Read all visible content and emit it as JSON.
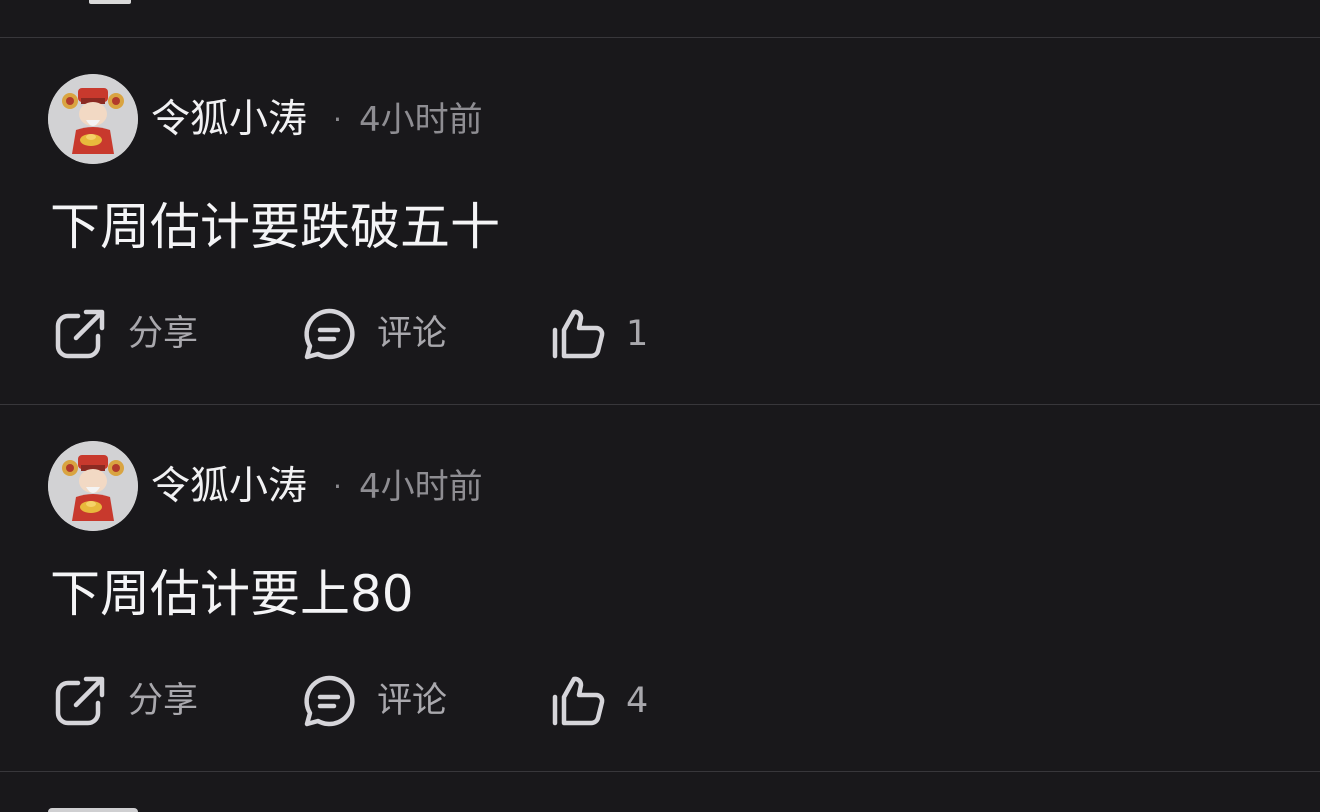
{
  "posts": [
    {
      "author": "令狐小涛",
      "separator": "·",
      "time": "4小时前",
      "content": "下周估计要跌破五十",
      "actions": {
        "share": "分享",
        "comment": "评论",
        "likes": "1"
      }
    },
    {
      "author": "令狐小涛",
      "separator": "·",
      "time": "4小时前",
      "content": "下周估计要上80",
      "actions": {
        "share": "分享",
        "comment": "评论",
        "likes": "4"
      }
    }
  ],
  "icons": {
    "share": "share-icon",
    "comment": "comment-icon",
    "like": "thumbs-up-icon",
    "avatar": "avatar-caishen"
  },
  "colors": {
    "background": "#19181b",
    "divider": "#38373b",
    "primary_text": "#f1f1f3",
    "secondary_text": "#a9a8ad"
  }
}
